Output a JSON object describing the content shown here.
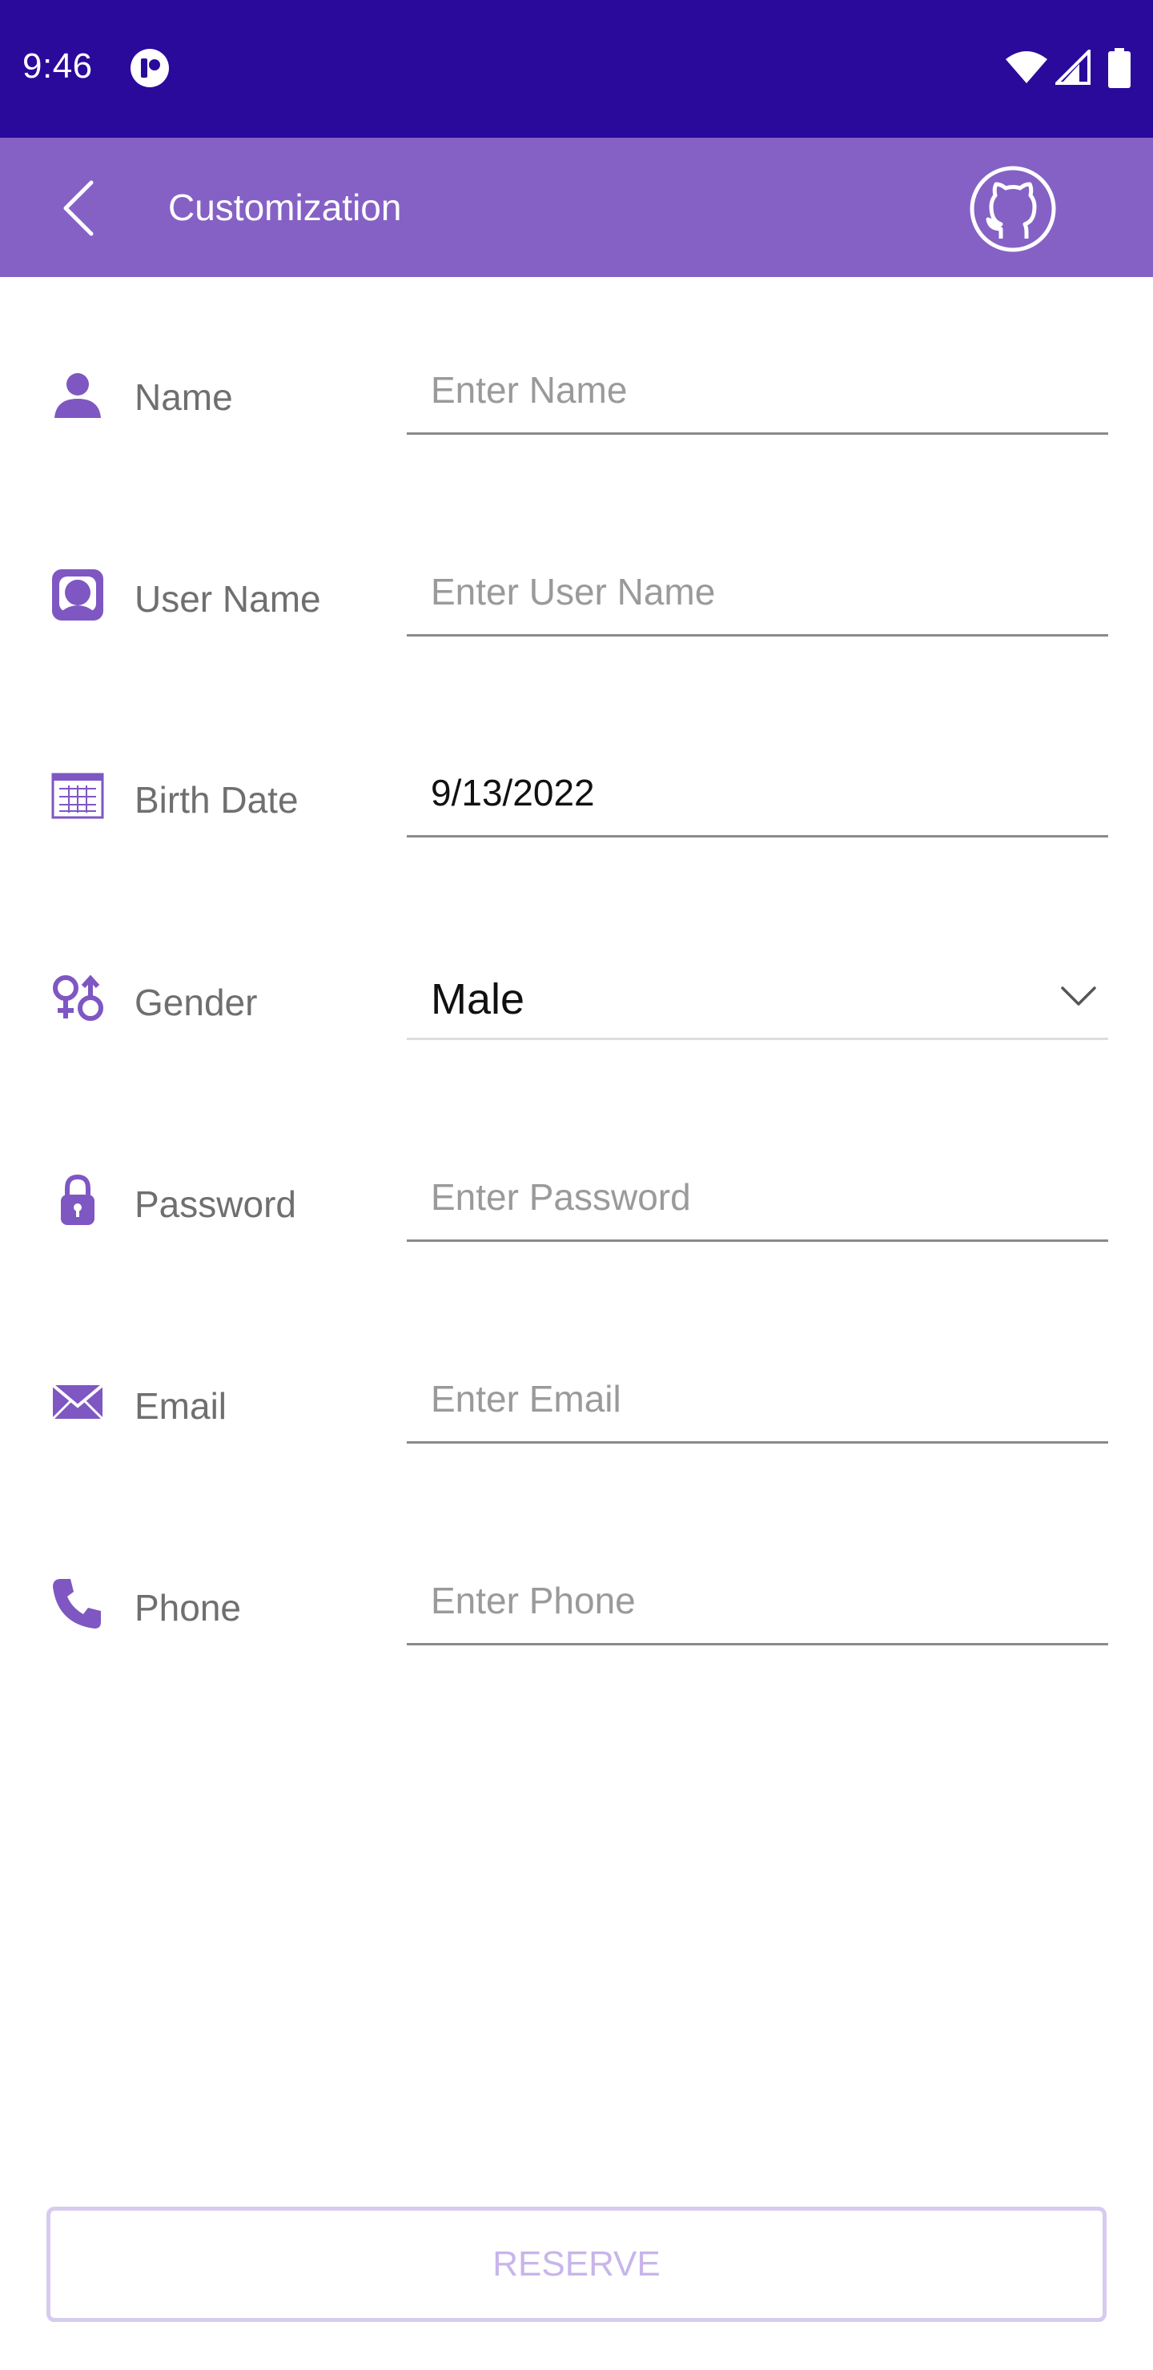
{
  "status_bar": {
    "time": "9:46",
    "icons": [
      "app-notification-icon",
      "wifi-icon",
      "signal-icon",
      "battery-icon"
    ]
  },
  "app_bar": {
    "title": "Customization",
    "back_icon": "chevron-left-icon",
    "action_icon": "github-icon",
    "background": "#8561c5"
  },
  "form": {
    "name": {
      "label": "Name",
      "placeholder": "Enter Name",
      "value": "",
      "icon": "person-icon"
    },
    "username": {
      "label": "User Name",
      "placeholder": "Enter User Name",
      "value": "",
      "icon": "user-frame-icon"
    },
    "birthdate": {
      "label": "Birth Date",
      "value": "9/13/2022",
      "icon": "calendar-icon"
    },
    "gender": {
      "label": "Gender",
      "value": "Male",
      "icon": "gender-icon"
    },
    "password": {
      "label": "Password",
      "placeholder": "Enter Password",
      "value": "",
      "icon": "lock-icon"
    },
    "email": {
      "label": "Email",
      "placeholder": "Enter Email",
      "value": "",
      "icon": "envelope-icon"
    },
    "phone": {
      "label": "Phone",
      "placeholder": "Enter Phone",
      "value": "",
      "icon": "phone-icon"
    }
  },
  "reserve_button": {
    "label": "RESERVE",
    "enabled": false
  },
  "colors": {
    "status_bar": "#2a0a9a",
    "accent": "#8561c5",
    "disabled_text": "#c8b5ea"
  }
}
